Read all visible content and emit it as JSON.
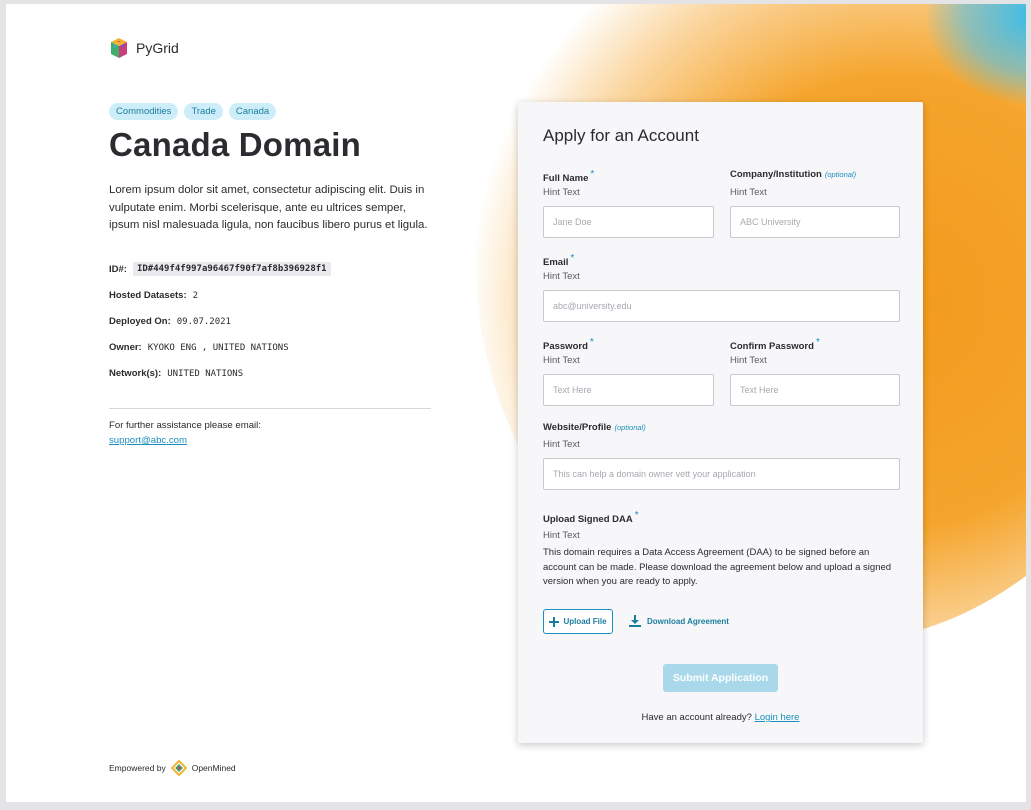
{
  "brand": {
    "name": "PyGrid"
  },
  "tags": [
    "Commodities",
    "Trade",
    "Canada"
  ],
  "domain": {
    "title": "Canada Domain",
    "description": "Lorem ipsum dolor sit amet, consectetur adipiscing elit. Duis in vulputate enim. Morbi scelerisque, ante eu ultrices semper, ipsum nisl malesuada ligula, non faucibus libero purus et ligula."
  },
  "meta": {
    "id_label": "ID#:",
    "id_value": "ID#449f4f997a96467f90f7af8b396928f1",
    "datasets_label": "Hosted Datasets:",
    "datasets_value": "2",
    "deployed_label": "Deployed On:",
    "deployed_value": "09.07.2021",
    "owner_label": "Owner:",
    "owner_value": "KYOKO ENG , UNITED NATIONS",
    "network_label": "Network(s):",
    "network_value": "UNITED NATIONS"
  },
  "help": {
    "text": "For further assistance please email:",
    "email": "support@abc.com"
  },
  "footer": {
    "prefix": "Empowered by",
    "brand": "OpenMined"
  },
  "form": {
    "title": "Apply for an Account",
    "required_mark": "*",
    "optional_mark": "(optional)",
    "hint": "Hint Text",
    "full_name": {
      "label": "Full Name",
      "placeholder": "Jane Doe"
    },
    "company": {
      "label": "Company/Institution",
      "placeholder": "ABC University"
    },
    "email": {
      "label": "Email",
      "placeholder": "abc@university.edu"
    },
    "password": {
      "label": "Password",
      "placeholder": "Text Here"
    },
    "confirm_password": {
      "label": "Confirm Password",
      "placeholder": "Text Here"
    },
    "website": {
      "label": "Website/Profile",
      "placeholder": "This can help a domain owner vett your application"
    },
    "daa": {
      "label": "Upload Signed DAA",
      "description": "This domain requires a Data Access Agreement (DAA) to be signed before an account can be made. Please download the agreement below and upload a signed version when you are ready to apply."
    },
    "upload_label": "Upload File",
    "download_label": "Download Agreement",
    "submit_label": "Submit Application",
    "login_prompt": "Have an account already?",
    "login_link": "Login here"
  },
  "colors": {
    "accent": "#1b8fbd",
    "tag_bg": "#cdeef9",
    "submit_disabled": "#a9d8ea",
    "blob": "#f29a1e"
  }
}
